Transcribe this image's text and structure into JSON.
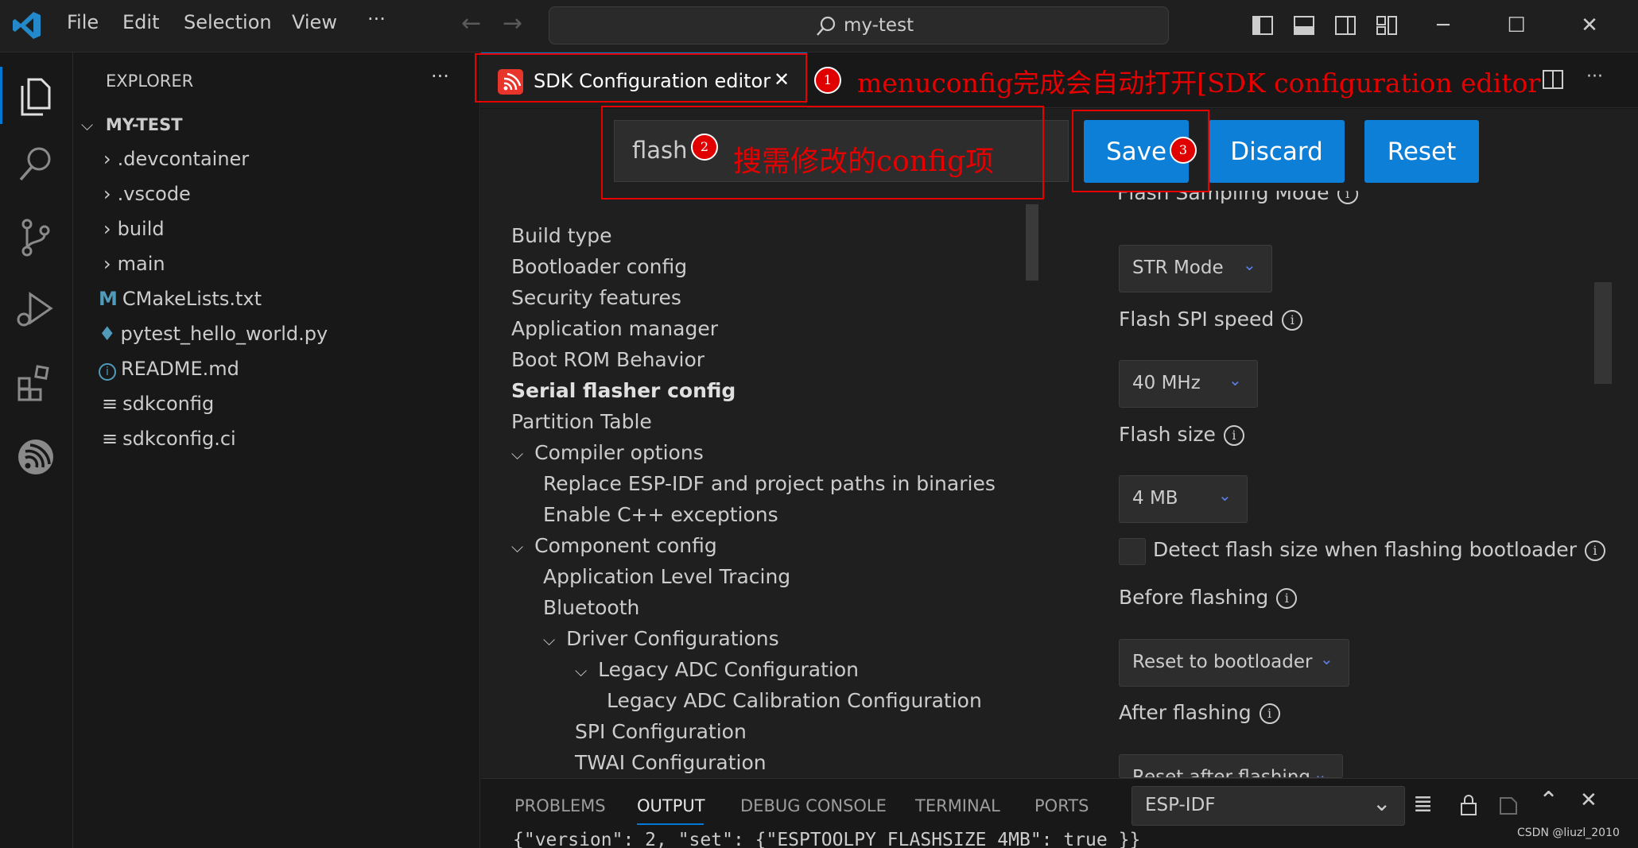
{
  "titlebar": {
    "menu": [
      "File",
      "Edit",
      "Selection",
      "View",
      "···"
    ],
    "search_text": "my-test"
  },
  "sidebar": {
    "title": "EXPLORER",
    "more": "···",
    "root": "MY-TEST",
    "items": [
      {
        "label": ".devcontainer",
        "kind": "folder"
      },
      {
        "label": ".vscode",
        "kind": "folder"
      },
      {
        "label": "build",
        "kind": "folder"
      },
      {
        "label": "main",
        "kind": "folder"
      },
      {
        "label": "CMakeLists.txt",
        "kind": "cmake"
      },
      {
        "label": "pytest_hello_world.py",
        "kind": "python"
      },
      {
        "label": "README.md",
        "kind": "info"
      },
      {
        "label": "sdkconfig",
        "kind": "text"
      },
      {
        "label": "sdkconfig.ci",
        "kind": "text"
      }
    ]
  },
  "tab": {
    "label": "SDK Configuration editor",
    "close": "✕"
  },
  "toolbar": {
    "search_value": "flash",
    "save_label": "Save",
    "discard_label": "Discard",
    "reset_label": "Reset"
  },
  "menu_tree": [
    "Build type",
    "Bootloader config",
    "Security features",
    "Application manager",
    "Boot ROM Behavior",
    "Serial flasher config",
    "Partition Table",
    "Compiler options",
    "Replace ESP-IDF and project paths in binaries",
    "Enable C++ exceptions",
    "Component config",
    "Application Level Tracing",
    "Bluetooth",
    "Driver Configurations",
    "Legacy ADC Configuration",
    "Legacy ADC Calibration Configuration",
    "SPI Configuration",
    "TWAI Configuration"
  ],
  "settings": {
    "sampling_label": "Flash Sampling Mode",
    "sampling_value": "STR Mode",
    "spi_speed_label": "Flash SPI speed",
    "spi_speed_value": "40 MHz",
    "size_label": "Flash size",
    "size_value": "4 MB",
    "detect_label": "Detect flash size when flashing bootloader",
    "before_label": "Before flashing",
    "before_value": "Reset to bootloader",
    "after_label": "After flashing",
    "after_value": "Reset after flashing"
  },
  "annotations": {
    "n1": "1",
    "n2": "2",
    "n3": "3",
    "text1": "menuconfig完成会自动打开[SDK configuration editor",
    "text2": "搜需修改的config项"
  },
  "panel": {
    "tabs": [
      "PROBLEMS",
      "OUTPUT",
      "DEBUG CONSOLE",
      "TERMINAL",
      "PORTS"
    ],
    "channel": "ESP-IDF",
    "output_line": "{\"version\": 2, \"set\": {\"ESPTOOLPY_FLASHSIZE_4MB\": true }}"
  },
  "watermark": "CSDN @liuzl_2010",
  "colors": {
    "accent": "#0078d4",
    "button": "#0e7fd6",
    "annotation": "#e60000"
  }
}
